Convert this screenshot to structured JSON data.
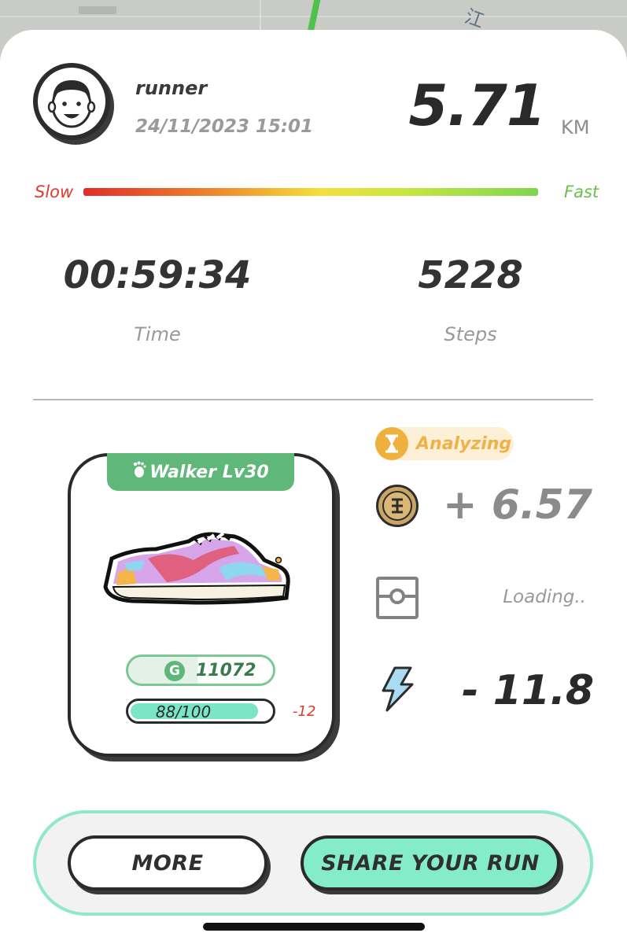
{
  "user": {
    "name": "runner",
    "datetime": "24/11/2023 15:01",
    "avatar_icon": "cartoon-face-icon"
  },
  "distance": {
    "value": "5.71",
    "unit": "KM"
  },
  "speed_meter": {
    "slow_label": "Slow",
    "fast_label": "Fast"
  },
  "stats": {
    "time": {
      "value": "00:59:34",
      "label": "Time"
    },
    "steps": {
      "value": "5228",
      "label": "Steps"
    }
  },
  "sneaker": {
    "tag_label": "Walker Lv30",
    "tag_icon": "footprint-icon",
    "gst_value": "11072",
    "gst_icon_letter": "G",
    "durability_text": "88/100",
    "durability_fraction": 0.88,
    "durability_change": "-12"
  },
  "rewards": {
    "status_label": "Analyzing",
    "status_icon": "hourglass-icon",
    "earn_value": "+ 6.57",
    "earn_icon": "gst-coin-icon",
    "mystery_box_text": "Loading..",
    "mystery_box_icon": "mystery-box-icon",
    "energy_value": "- 11.8",
    "energy_icon": "lightning-bolt-icon"
  },
  "actions": {
    "more_label": "MORE",
    "share_label": "SHARE YOUR RUN"
  },
  "colors": {
    "accent_green": "#5fb77a",
    "mint": "#84ecc8",
    "slow_red": "#e23a2a",
    "fast_green": "#6cc04a",
    "analyzing_orange": "#f0b03d"
  }
}
